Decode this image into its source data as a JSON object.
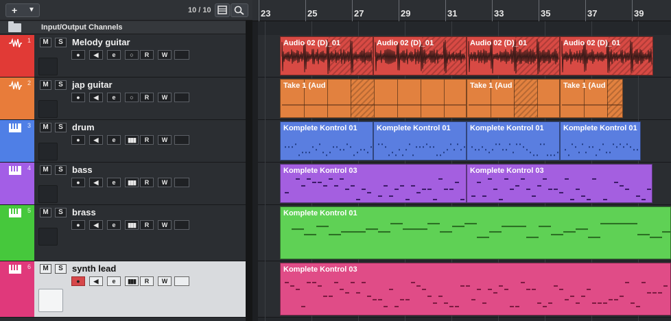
{
  "toolbar": {
    "add_label": "+",
    "track_count": "10 / 10"
  },
  "io_channels": {
    "label": "Input/Output Channels"
  },
  "ruler": {
    "bars": [
      "23",
      "25",
      "27",
      "29",
      "31",
      "33",
      "35",
      "37",
      "39"
    ]
  },
  "tracks": [
    {
      "num": "1",
      "name": "Melody guitar",
      "type": "audio",
      "color": "#e13a36",
      "controls": [
        "rec",
        "monitor",
        "edit",
        "freeze",
        "read",
        "write",
        "channel"
      ]
    },
    {
      "num": "2",
      "name": "jap guitar",
      "type": "audio",
      "color": "#e87c3a",
      "controls": [
        "rec",
        "monitor",
        "edit",
        "freeze",
        "read",
        "write",
        "channel"
      ]
    },
    {
      "num": "3",
      "name": "drum",
      "type": "instrument",
      "color": "#4f7fe6",
      "controls": [
        "rec",
        "monitor",
        "edit",
        "keys",
        "read",
        "write",
        "channel"
      ]
    },
    {
      "num": "4",
      "name": "bass",
      "type": "instrument",
      "color": "#a35ee6",
      "controls": [
        "rec",
        "monitor",
        "edit",
        "keys",
        "read",
        "write",
        "channel"
      ]
    },
    {
      "num": "5",
      "name": "brass",
      "type": "instrument",
      "color": "#46c83c",
      "controls": [
        "rec",
        "monitor",
        "edit",
        "keys",
        "read",
        "write",
        "channel"
      ]
    },
    {
      "num": "6",
      "name": "synth lead",
      "type": "instrument",
      "color": "#e0397b",
      "controls": [
        "rec",
        "monitor",
        "edit",
        "keys",
        "read",
        "write",
        "channel"
      ]
    }
  ],
  "events": {
    "track1": [
      "Audio 02 (D)_01",
      "Audio 02 (D)_01",
      "Audio 02 (D)_01",
      "Audio 02 (D)_01"
    ],
    "track2": [
      "Take 1 (Aud",
      "Take 1 (Aud",
      "Take 1 (Aud"
    ],
    "track3": [
      "Komplete Kontrol 01",
      "Komplete Kontrol 01",
      "Komplete Kontrol 01",
      "Komplete Kontrol 01"
    ],
    "track4": [
      "Komplete Kontrol 03",
      "Komplete Kontrol 03"
    ],
    "track5": [
      "Komplete Kontrol 01"
    ],
    "track6": [
      "Komplete Kontrol 03"
    ]
  },
  "colors": {
    "audio1": "#d84a44",
    "audio2": "#e2813f",
    "drum": "#5a7ee0",
    "bass": "#a45fe0",
    "brass": "#5fd155",
    "synth": "#e04c87"
  }
}
